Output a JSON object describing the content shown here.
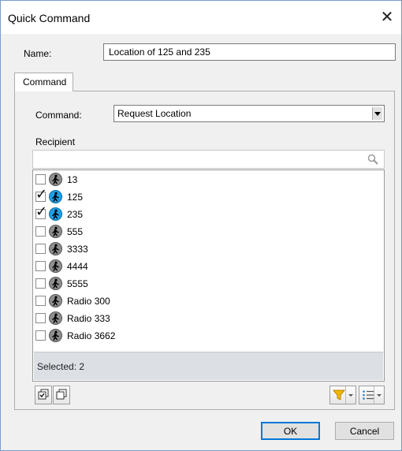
{
  "window": {
    "title": "Quick Command",
    "close_glyph": "✕"
  },
  "name_field": {
    "label": "Name:",
    "value": "Location of 125 and 235"
  },
  "tabs": [
    {
      "label": "Command"
    }
  ],
  "command": {
    "label": "Command:",
    "selected": "Request Location"
  },
  "recipient": {
    "label": "Recipient",
    "search_value": "",
    "items": [
      {
        "label": "13",
        "checked": false
      },
      {
        "label": "125",
        "checked": true
      },
      {
        "label": "235",
        "checked": true
      },
      {
        "label": "555",
        "checked": false
      },
      {
        "label": "3333",
        "checked": false
      },
      {
        "label": "4444",
        "checked": false
      },
      {
        "label": "5555",
        "checked": false
      },
      {
        "label": "Radio 300",
        "checked": false
      },
      {
        "label": "Radio 333",
        "checked": false
      },
      {
        "label": "Radio 3662",
        "checked": false
      }
    ],
    "selected_status": "Selected: 2"
  },
  "icons": {
    "search": "search-icon",
    "person": "walking-person-icon",
    "select_all": "select-all-icon",
    "deselect_all": "deselect-all-icon",
    "filter": "filter-icon",
    "list_view": "list-view-icon"
  },
  "colors": {
    "accent": "#0078d7",
    "selected_unit": "#1ca0e6",
    "unselected_unit": "#8e8e8e",
    "filter": "#f2b705",
    "footer_bg": "#dcdfe4"
  },
  "buttons": {
    "ok": "OK",
    "cancel": "Cancel"
  }
}
